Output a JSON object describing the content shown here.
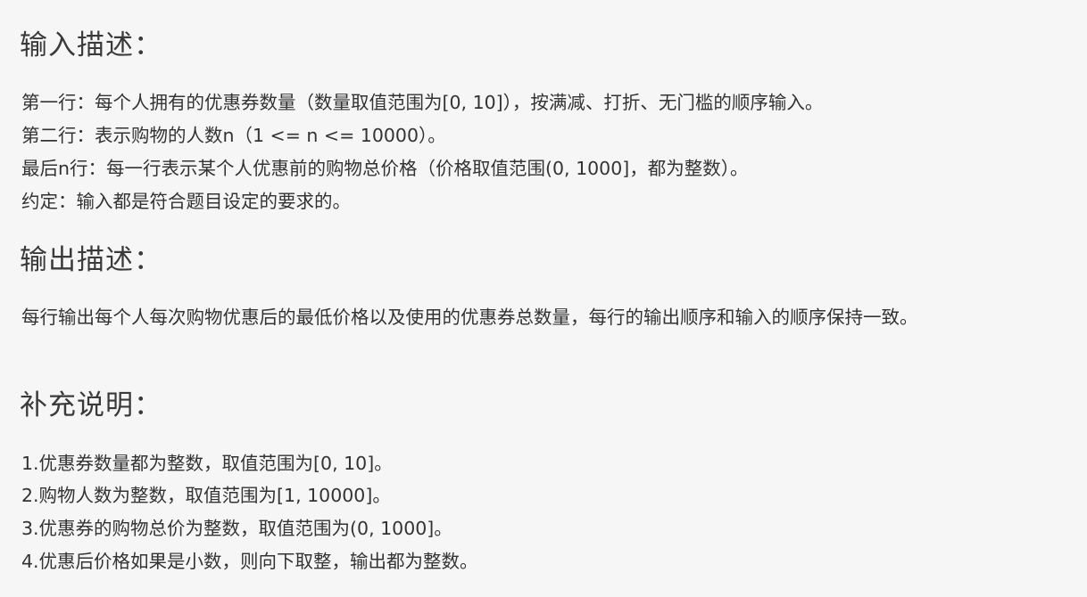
{
  "input_section": {
    "heading": "输入描述：",
    "lines": [
      "第一行：每个人拥有的优惠券数量（数量取值范围为[0, 10]），按满减、打折、无门槛的顺序输入。",
      "第二行：表示购物的人数n（1 <= n <= 10000）。",
      "最后n行：每一行表示某个人优惠前的购物总价格（价格取值范围(0, 1000]，都为整数）。",
      "约定：输入都是符合题目设定的要求的。"
    ]
  },
  "output_section": {
    "heading": "输出描述：",
    "text": "每行输出每个人每次购物优惠后的最低价格以及使用的优惠券总数量，每行的输出顺序和输入的顺序保持一致。"
  },
  "notes_section": {
    "heading": "补充说明：",
    "lines": [
      "1.优惠券数量都为整数，取值范围为[0, 10]。",
      "2.购物人数为整数，取值范围为[1, 10000]。",
      "3.优惠券的购物总价为整数，取值范围为(0, 1000]。",
      "4.优惠后价格如果是小数，则向下取整，输出都为整数。"
    ]
  }
}
